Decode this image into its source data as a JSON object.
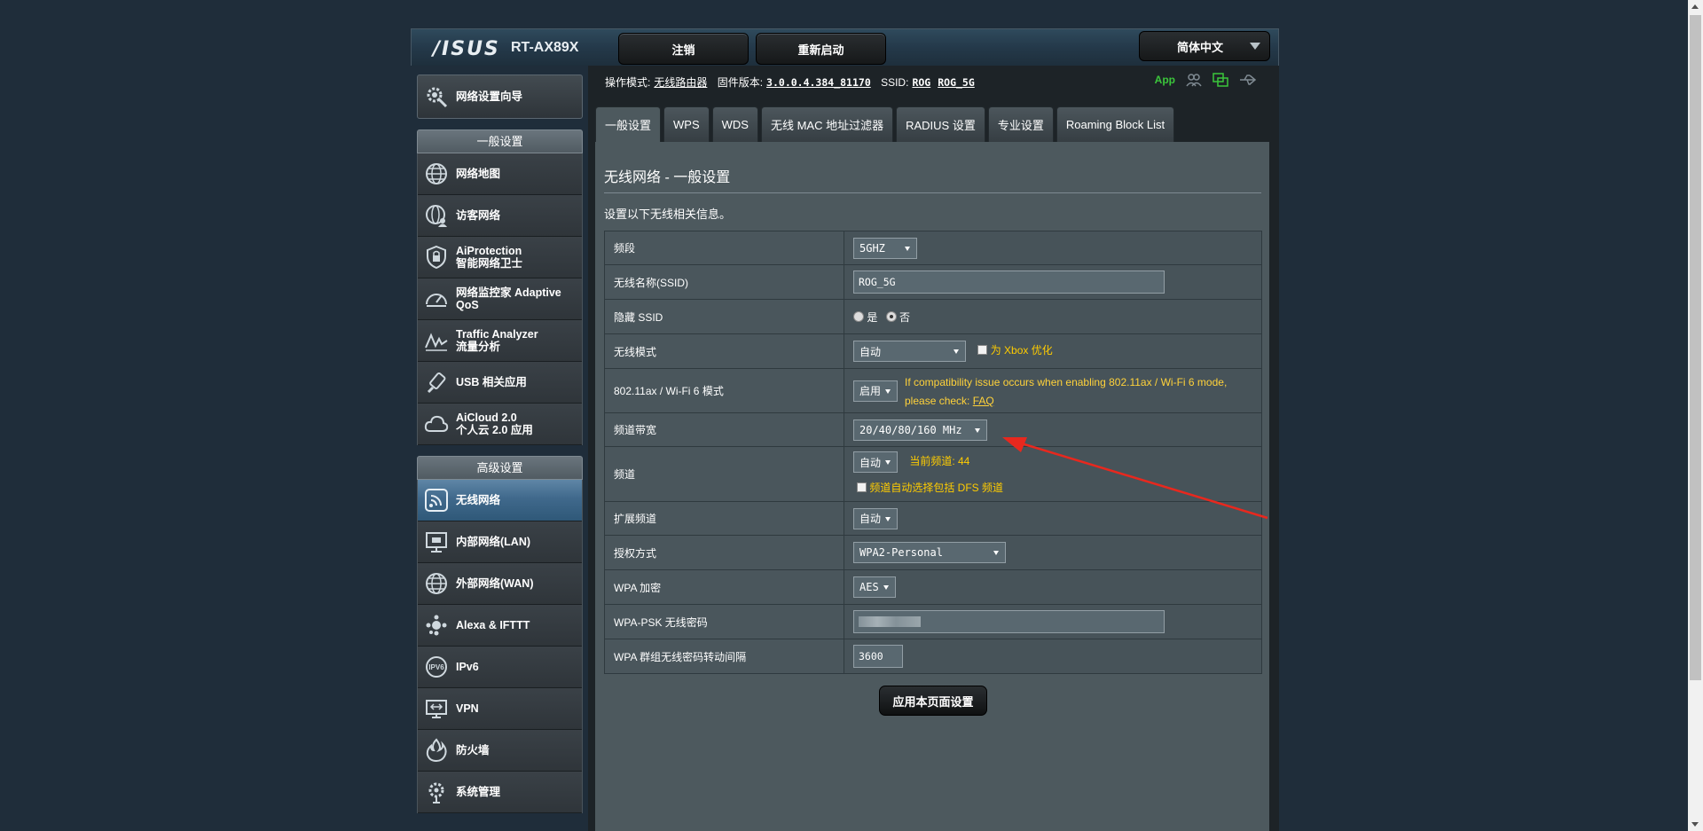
{
  "header": {
    "logo": "/ISUS",
    "model": "RT-AX89X",
    "logout_label": "注销",
    "reboot_label": "重新启动",
    "language": "简体中文"
  },
  "status": {
    "mode_label": "操作模式:",
    "mode_value": "无线路由器",
    "firmware_label": "固件版本:",
    "firmware_value": "3.0.0.4.384_81170",
    "ssid_label": "SSID:",
    "ssid_1": "ROG",
    "ssid_2": "ROG_5G",
    "app_label": "App"
  },
  "sidebar": {
    "wizard": "网络设置向导",
    "general_head": "一般设置",
    "general_items": [
      {
        "label": "网络地图",
        "icon": "globe-icon"
      },
      {
        "label": "访客网络",
        "icon": "guest-network-icon"
      },
      {
        "label": "AiProtection",
        "label2": "智能网络卫士",
        "icon": "shield-icon"
      },
      {
        "label": "网络监控家 Adaptive",
        "label2": "QoS",
        "icon": "speedometer-icon"
      },
      {
        "label": "Traffic Analyzer",
        "label2": "流量分析",
        "icon": "traffic-icon"
      },
      {
        "label": "USB 相关应用",
        "icon": "usb-icon"
      },
      {
        "label": "AiCloud 2.0",
        "label2": "个人云 2.0 应用",
        "icon": "cloud-icon"
      }
    ],
    "advanced_head": "高级设置",
    "advanced_items": [
      {
        "label": "无线网络",
        "icon": "wifi-icon",
        "active": true
      },
      {
        "label": "内部网络(LAN)",
        "icon": "lan-icon"
      },
      {
        "label": "外部网络(WAN)",
        "icon": "wan-globe-icon"
      },
      {
        "label": "Alexa & IFTTT",
        "icon": "alexa-icon"
      },
      {
        "label": "IPv6",
        "icon": "ipv6-icon"
      },
      {
        "label": "VPN",
        "icon": "vpn-icon"
      },
      {
        "label": "防火墙",
        "icon": "firewall-icon"
      },
      {
        "label": "系统管理",
        "icon": "gear-icon"
      }
    ]
  },
  "tabs": [
    "一般设置",
    "WPS",
    "WDS",
    "无线 MAC 地址过滤器",
    "RADIUS 设置",
    "专业设置",
    "Roaming Block List"
  ],
  "page": {
    "title": "无线网络 - 一般设置",
    "desc": "设置以下无线相关信息。",
    "rows": {
      "band_label": "频段",
      "band_value": "5GHZ",
      "ssid_label": "无线名称(SSID)",
      "ssid_value": "ROG_5G",
      "hide_label": "隐藏 SSID",
      "hide_yes": "是",
      "hide_no": "否",
      "mode_label": "无线模式",
      "mode_value": "自动",
      "xbox_label": "为 Xbox 优化",
      "ax_label": "802.11ax / Wi-Fi 6 模式",
      "ax_value": "启用",
      "ax_note1": "If compatibility issue occurs when enabling 802.11ax / Wi-Fi 6 mode,",
      "ax_note2": "please check:",
      "ax_faq": "FAQ",
      "bw_label": "频道带宽",
      "bw_value": "20/40/80/160 MHz",
      "ch_label": "频道",
      "ch_value": "自动",
      "ch_current": "当前频道: 44",
      "dfs_label": "频道自动选择包括 DFS 频道",
      "ext_label": "扩展频道",
      "ext_value": "自动",
      "auth_label": "授权方式",
      "auth_value": "WPA2-Personal",
      "enc_label": "WPA 加密",
      "enc_value": "AES",
      "psk_label": "WPA-PSK 无线密码",
      "gk_label": "WPA 群组无线密码转动间隔",
      "gk_value": "3600"
    },
    "apply_label": "应用本页面设置"
  },
  "colors": {
    "background": "#1f2d3a",
    "panel": "#4d595e",
    "active_nav": "#40698c",
    "note_orange": "#ffcc00",
    "app_green": "#3bc63b",
    "annotation_arrow": "#e8281e"
  }
}
